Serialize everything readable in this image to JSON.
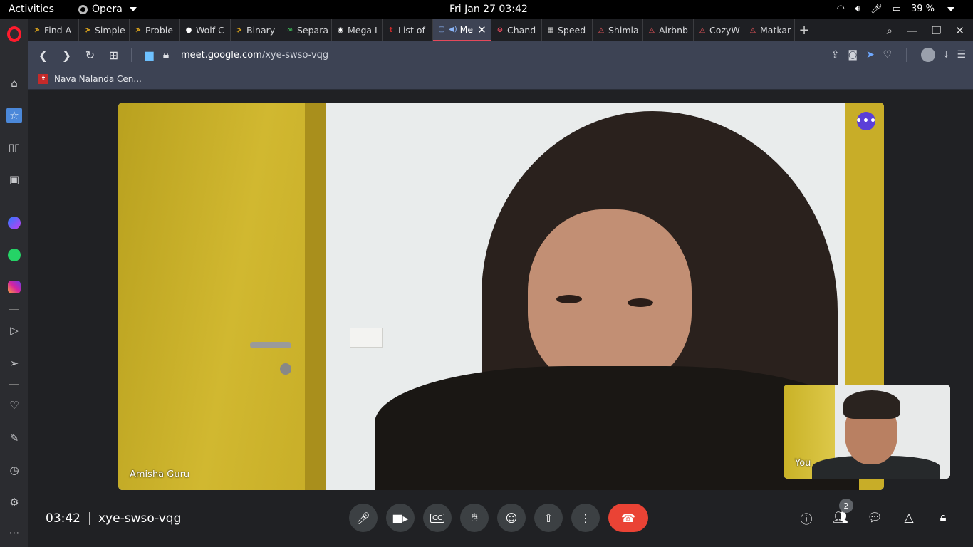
{
  "system": {
    "activities": "Activities",
    "app_name": "Opera",
    "clock": "Fri Jan 27  03:42",
    "battery": "39 %"
  },
  "tabs": [
    {
      "label": "Find A",
      "fav": "≯",
      "favcolor": "#d9a21b"
    },
    {
      "label": "Simple",
      "fav": "≯",
      "favcolor": "#d9a21b"
    },
    {
      "label": "Proble",
      "fav": "≯",
      "favcolor": "#d9a21b"
    },
    {
      "label": "Wolf C",
      "fav": "●",
      "favcolor": "#ffffff"
    },
    {
      "label": "Binary",
      "fav": "≯",
      "favcolor": "#d9a21b"
    },
    {
      "label": "Separa",
      "fav": "∞",
      "favcolor": "#3fbf5a"
    },
    {
      "label": "Mega I",
      "fav": "◉",
      "favcolor": "#ffffff"
    },
    {
      "label": "List of",
      "fav": "t",
      "favcolor": "#c52a2a"
    },
    {
      "label": "Me",
      "fav": "▢",
      "favcolor": "#8ab4f8",
      "active": true
    },
    {
      "label": "Chand",
      "fav": "⊝",
      "favcolor": "#e5495b"
    },
    {
      "label": "Speed",
      "fav": "▦",
      "favcolor": "#cccccc"
    },
    {
      "label": "Shimla",
      "fav": "◬",
      "favcolor": "#ff5a5f"
    },
    {
      "label": "Airbnb",
      "fav": "◬",
      "favcolor": "#ff5a5f"
    },
    {
      "label": "CozyW",
      "fav": "◬",
      "favcolor": "#ff5a5f"
    },
    {
      "label": "Matkar",
      "fav": "◬",
      "favcolor": "#ff5a5f"
    }
  ],
  "address": {
    "domain": "meet.google.com",
    "path": "/xye-swso-vqg"
  },
  "bookmarks": [
    {
      "label": "Nava Nalanda Cen..."
    }
  ],
  "meet": {
    "participant_name": "Amisha Guru",
    "self_label": "You",
    "time": "03:42",
    "meeting_code": "xye-swso-vqg",
    "people_count": "2"
  },
  "icons": {
    "end_call_color": "#ea4335",
    "accent": "#5b3fd8"
  }
}
